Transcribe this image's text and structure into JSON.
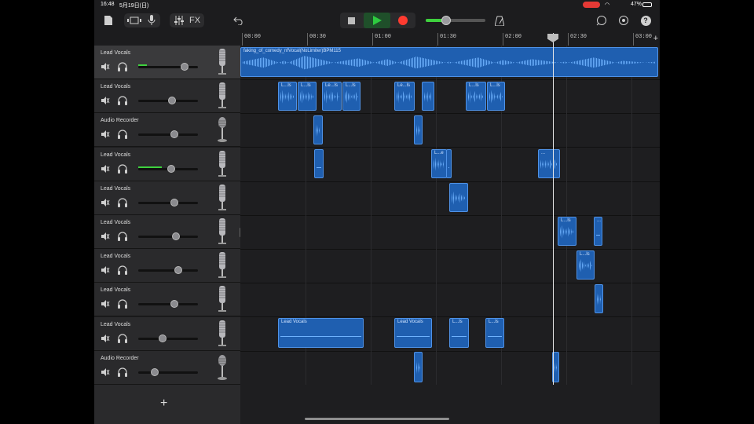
{
  "status": {
    "time": "16:48",
    "date": "5月19日(日)",
    "battery": "47%"
  },
  "toolbar": {
    "fx_label": "FX"
  },
  "ruler": {
    "labels": [
      "00:00",
      "00:30",
      "01:00",
      "01:30",
      "02:00",
      "02:30",
      "03:00"
    ],
    "add": "+"
  },
  "tracks": [
    {
      "name": "Lead Vocals",
      "level": 0.77,
      "meter": 0.14,
      "selected": true,
      "mic": "condenser"
    },
    {
      "name": "Lead Vocals",
      "level": 0.57,
      "meter": 0,
      "mic": "condenser"
    },
    {
      "name": "Audio Recorder",
      "level": 0.61,
      "meter": 0,
      "mic": "dynamic"
    },
    {
      "name": "Lead Vocals",
      "level": 0.55,
      "meter": 0.39,
      "mic": "condenser"
    },
    {
      "name": "Lead Vocals",
      "level": 0.6,
      "meter": 0,
      "mic": "condenser"
    },
    {
      "name": "Lead Vocals",
      "level": 0.63,
      "meter": 0,
      "mic": "condenser"
    },
    {
      "name": "Lead Vocals",
      "level": 0.67,
      "meter": 0,
      "mic": "condenser"
    },
    {
      "name": "Lead Vocals",
      "level": 0.61,
      "meter": 0,
      "mic": "condenser"
    },
    {
      "name": "Lead Vocals",
      "level": 0.41,
      "meter": 0,
      "mic": "condenser"
    },
    {
      "name": "Audio Recorder",
      "level": 0.28,
      "meter": 0,
      "mic": "dynamic"
    }
  ],
  "regions": {
    "top_label": "faking_of_comedy_nfVocal(NoLimiter)BPM115",
    "l_is": "L...ls",
    "le_is": "Le...ls",
    "l_e": "L...e",
    "lead_vocals": "Lead Vocals",
    "dots": "..."
  },
  "add_track": "+",
  "colors": {
    "accent": "#1f5fb0",
    "play": "#2ecc40",
    "record": "#ff3b30",
    "meter": "#3ed13e"
  }
}
